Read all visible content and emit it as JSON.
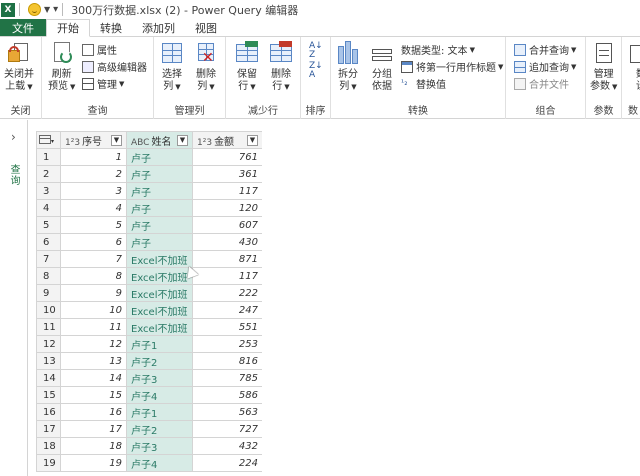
{
  "titlebar": {
    "app_icon_label": "X",
    "title": "300万行数据.xlsx (2) - Power Query 编辑器"
  },
  "tabs": [
    {
      "label": "文件"
    },
    {
      "label": "开始"
    },
    {
      "label": "转换"
    },
    {
      "label": "添加列"
    },
    {
      "label": "视图"
    }
  ],
  "ribbon": {
    "close": {
      "group": "关闭",
      "close_load_l1": "关闭并",
      "close_load_l2": "上载"
    },
    "query": {
      "group": "查询",
      "refresh_l1": "刷新",
      "refresh_l2": "预览",
      "properties": "属性",
      "advanced_editor": "高级编辑器",
      "manage": "管理"
    },
    "manage_cols": {
      "group": "管理列",
      "choose_l1": "选择",
      "choose_l2": "列",
      "remove_l1": "删除",
      "remove_l2": "列"
    },
    "reduce_rows": {
      "group": "减少行",
      "keep_l1": "保留",
      "keep_l2": "行",
      "remove_l1": "删除",
      "remove_l2": "行"
    },
    "sort": {
      "group": "排序"
    },
    "transform": {
      "group": "转换",
      "split_l1": "拆分",
      "split_l2": "列",
      "groupby_l1": "分组",
      "groupby_l2": "依据",
      "datatype": "数据类型: 文本",
      "first_row_header": "将第一行用作标题",
      "replace_values": "替换值"
    },
    "combine": {
      "group": "组合",
      "merge": "合并查询",
      "append": "追加查询",
      "combine_files": "合并文件"
    },
    "params": {
      "group": "参数",
      "manage_l1": "管理",
      "manage_l2": "参数"
    },
    "datasource": {
      "group": "数",
      "l1": "数",
      "l2": "设"
    }
  },
  "leftpane": {
    "label": "查询"
  },
  "grid": {
    "columns": [
      {
        "type": "1²3",
        "name": "序号"
      },
      {
        "type": "ABC",
        "name": "姓名"
      },
      {
        "type": "1²3",
        "name": "金额"
      }
    ],
    "rows": [
      {
        "rn": "1",
        "id": "1",
        "name": "卢子",
        "amount": "761"
      },
      {
        "rn": "2",
        "id": "2",
        "name": "卢子",
        "amount": "361"
      },
      {
        "rn": "3",
        "id": "3",
        "name": "卢子",
        "amount": "117"
      },
      {
        "rn": "4",
        "id": "4",
        "name": "卢子",
        "amount": "120"
      },
      {
        "rn": "5",
        "id": "5",
        "name": "卢子",
        "amount": "607"
      },
      {
        "rn": "6",
        "id": "6",
        "name": "卢子",
        "amount": "430"
      },
      {
        "rn": "7",
        "id": "7",
        "name": "Excel不加班",
        "amount": "871"
      },
      {
        "rn": "8",
        "id": "8",
        "name": "Excel不加班",
        "amount": "117"
      },
      {
        "rn": "9",
        "id": "9",
        "name": "Excel不加班",
        "amount": "222"
      },
      {
        "rn": "10",
        "id": "10",
        "name": "Excel不加班",
        "amount": "247"
      },
      {
        "rn": "11",
        "id": "11",
        "name": "Excel不加班",
        "amount": "551"
      },
      {
        "rn": "12",
        "id": "12",
        "name": "卢子1",
        "amount": "253"
      },
      {
        "rn": "13",
        "id": "13",
        "name": "卢子2",
        "amount": "816"
      },
      {
        "rn": "14",
        "id": "14",
        "name": "卢子3",
        "amount": "785"
      },
      {
        "rn": "15",
        "id": "15",
        "name": "卢子4",
        "amount": "586"
      },
      {
        "rn": "16",
        "id": "16",
        "name": "卢子1",
        "amount": "563"
      },
      {
        "rn": "17",
        "id": "17",
        "name": "卢子2",
        "amount": "727"
      },
      {
        "rn": "18",
        "id": "18",
        "name": "卢子3",
        "amount": "432"
      },
      {
        "rn": "19",
        "id": "19",
        "name": "卢子4",
        "amount": "224"
      }
    ]
  },
  "colors": {
    "excel_green": "#217346",
    "name_col_fill": "#d7ebe6"
  }
}
